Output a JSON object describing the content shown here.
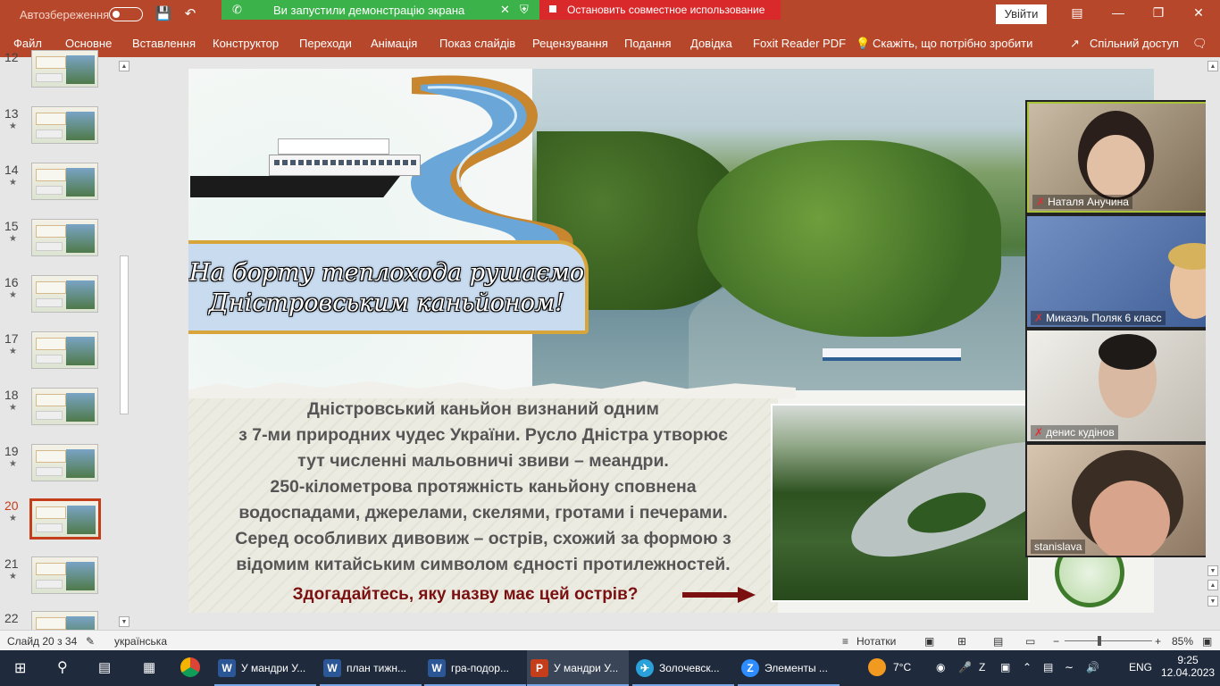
{
  "titlebar": {
    "autosave_label": "Автозбереження",
    "screen_share_notice": "Ви запустили демонстрацію экрана",
    "stop_sharing_label": "Остановить совместное использование",
    "signin_label": "Увійти"
  },
  "ribbon": {
    "tabs": [
      "Файл",
      "Основне",
      "Вставлення",
      "Конструктор",
      "Переходи",
      "Анімація",
      "Показ слайдів",
      "Рецензування",
      "Подання",
      "Довідка",
      "Foxit Reader PDF"
    ],
    "tell_me": "Скажіть, що потрібно зробити",
    "share": "Спільний доступ"
  },
  "slides_panel": {
    "items": [
      {
        "num": "12"
      },
      {
        "num": "13"
      },
      {
        "num": "14"
      },
      {
        "num": "15"
      },
      {
        "num": "16"
      },
      {
        "num": "17"
      },
      {
        "num": "18"
      },
      {
        "num": "19"
      },
      {
        "num": "20"
      },
      {
        "num": "21"
      },
      {
        "num": "22"
      }
    ],
    "active": "20"
  },
  "slide": {
    "banner_line1": "На борту теплохода рушаємо",
    "banner_line2": "Дністровським каньйоном!",
    "body_lines": [
      "Дністровський каньйон визнаний одним",
      "з 7-ми природних чудес України. Русло Дністра утворює",
      "тут численні мальовничі звиви –  меандри.",
      "250-кілометрова протяжність каньйону сповнена",
      "водоспадами, джерелами, скелями, гротами і печерами.",
      "Серед особливих дивовиж – острів, схожий за формою з",
      "відомим китайським символом єдності протилежностей."
    ],
    "question": "Здогадайтесь, яку назву має цей острів?"
  },
  "participants": [
    {
      "name": "Наталя Анучина",
      "muted": true
    },
    {
      "name": "Микаэль Поляк 6 класс",
      "muted": true
    },
    {
      "name": "денис кудінов",
      "muted": true
    },
    {
      "name": "stanislava",
      "muted": false
    }
  ],
  "statusbar": {
    "slide_counter": "Слайд 20 з 34",
    "language": "українська",
    "notes_label": "Нотатки",
    "zoom": "85%"
  },
  "taskbar": {
    "tasks": [
      {
        "label": "У мандри У...",
        "icon": "W",
        "color": "#2b5797"
      },
      {
        "label": "план тижн...",
        "icon": "W",
        "color": "#2b5797"
      },
      {
        "label": "гра-подор...",
        "icon": "W",
        "color": "#2b5797"
      },
      {
        "label": "У мандри У...",
        "icon": "P",
        "color": "#c43e1c"
      },
      {
        "label": "Золочевск...",
        "icon": "✈",
        "color": "#2aa1d8"
      },
      {
        "label": "Элементы ...",
        "icon": "Z",
        "color": "#2d8cff"
      }
    ],
    "weather": "7°C",
    "lang": "ENG",
    "time": "9:25",
    "date": "12.04.2023"
  },
  "colors": {
    "ppt_red": "#b7472a",
    "accent_active": "#c43e1c",
    "share_green": "#3cb34a",
    "share_red": "#d9292b"
  }
}
